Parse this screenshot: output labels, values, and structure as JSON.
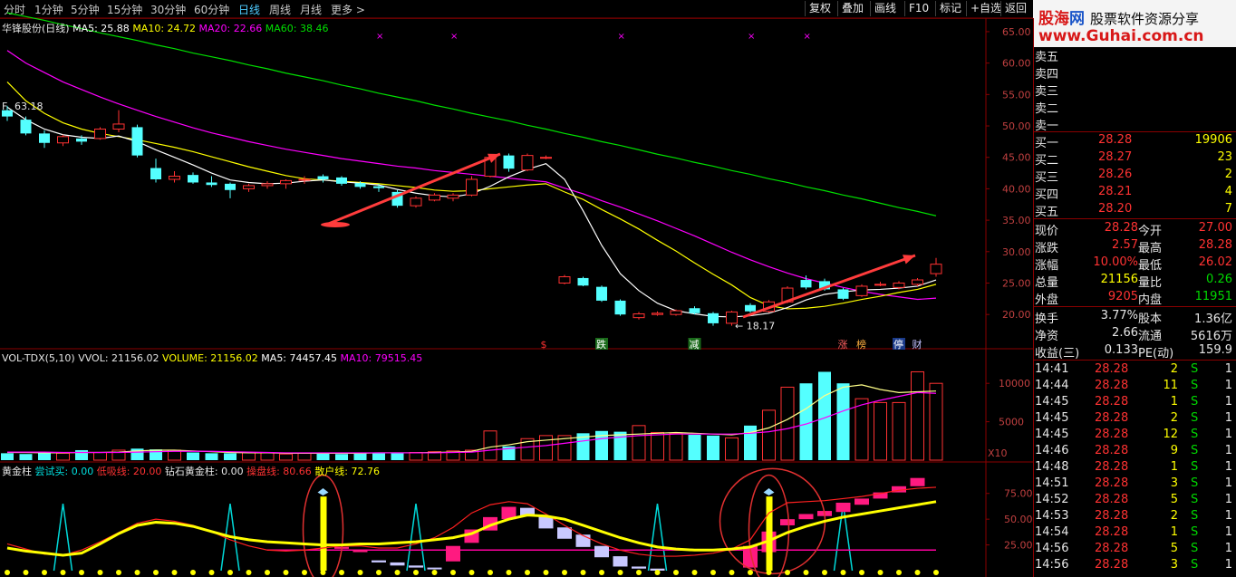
{
  "toolbar": {
    "periods": [
      "分时",
      "1分钟",
      "5分钟",
      "15分钟",
      "30分钟",
      "60分钟",
      "日线",
      "周线",
      "月线",
      "更多 >"
    ],
    "active": "日线",
    "buttons": [
      "复权",
      "叠加",
      "画线",
      "F10",
      "标记",
      "+自选",
      "返回"
    ]
  },
  "brand": {
    "name_part1": "股海",
    "name_part2": "网",
    "tagline": "股票软件资源分享",
    "url": "www.Guhai.com.cn"
  },
  "colors": {
    "up": "#ff3232",
    "down": "#54ffff",
    "ma5": "#ffffff",
    "ma10": "#ffff00",
    "ma20": "#ff00ff",
    "ma60": "#00e000",
    "grid": "#8a0000",
    "green": "#00d800"
  },
  "main_info": {
    "title": "华锋股份(日线)",
    "ma5": "MA5: 25.88",
    "ma10": "MA10: 24.72",
    "ma20": "MA20: 22.66",
    "ma60": "MA60: 38.46"
  },
  "vol_info": {
    "title": "VOL-TDX(5,10)",
    "vvol": "VVOL: 21156.02",
    "volume": "VOLUME: 21156.02",
    "ma5": "MA5: 74457.45",
    "ma10": "MA10: 79515.45"
  },
  "gold_info": {
    "title": "黄金柱",
    "try_buy": "尝试买: 0.00",
    "low_suck": "低吸线: 20.00",
    "diamond": "钻石黄金柱: 0.00",
    "operator": "操盘线: 80.66",
    "retail": "散户线: 72.76"
  },
  "price_axis": [
    "65.00",
    "60.00",
    "55.00",
    "50.00",
    "45.00",
    "40.00",
    "35.00",
    "30.00",
    "25.00",
    "20.00"
  ],
  "vol_axis": [
    "10000",
    "5000"
  ],
  "vol_unit": "X10",
  "gold_axis": [
    "75.00",
    "50.00",
    "25.00"
  ],
  "annotations": {
    "high": "63.18",
    "low": "18.17",
    "high_prefix": "F"
  },
  "event_labels": [
    {
      "text": "$",
      "color": "#ff3232"
    },
    {
      "text": "跌",
      "color": "#ffffff",
      "bg": "#1a6a1a"
    },
    {
      "text": "减",
      "color": "#ffffff",
      "bg": "#1a6a1a"
    },
    {
      "text": "涨",
      "color": "#ff6060"
    },
    {
      "text": "榜",
      "color": "#ffb040"
    },
    {
      "text": "停",
      "color": "#ffffff",
      "bg": "#1a3a8a"
    },
    {
      "text": "财",
      "color": "#c0c0ff"
    }
  ],
  "chart_data": {
    "type": "candlestick",
    "candles": [
      {
        "o": 52.5,
        "c": 51.5,
        "h": 53.2,
        "l": 50.8
      },
      {
        "o": 51.0,
        "c": 48.8,
        "h": 51.5,
        "l": 48.5
      },
      {
        "o": 48.8,
        "c": 47.3,
        "h": 49.3,
        "l": 46.5
      },
      {
        "o": 47.3,
        "c": 48.3,
        "h": 48.6,
        "l": 46.8
      },
      {
        "o": 48.0,
        "c": 47.5,
        "h": 48.5,
        "l": 47.0
      },
      {
        "o": 48.0,
        "c": 49.5,
        "h": 49.8,
        "l": 47.8
      },
      {
        "o": 49.5,
        "c": 50.3,
        "h": 52.5,
        "l": 49.0
      },
      {
        "o": 49.8,
        "c": 45.3,
        "h": 50.2,
        "l": 45.0
      },
      {
        "o": 43.3,
        "c": 41.5,
        "h": 44.8,
        "l": 41.0
      },
      {
        "o": 41.5,
        "c": 42.0,
        "h": 42.8,
        "l": 41.0
      },
      {
        "o": 42.2,
        "c": 41.0,
        "h": 42.6,
        "l": 40.8
      },
      {
        "o": 41.0,
        "c": 40.6,
        "h": 42.0,
        "l": 40.3
      },
      {
        "o": 40.8,
        "c": 39.8,
        "h": 41.0,
        "l": 38.5
      },
      {
        "o": 40.0,
        "c": 40.5,
        "h": 40.8,
        "l": 39.5
      },
      {
        "o": 40.5,
        "c": 40.8,
        "h": 41.2,
        "l": 40.0
      },
      {
        "o": 40.8,
        "c": 41.3,
        "h": 41.5,
        "l": 40.0
      },
      {
        "o": 41.5,
        "c": 41.5,
        "h": 42.0,
        "l": 40.8
      },
      {
        "o": 42.0,
        "c": 41.5,
        "h": 42.3,
        "l": 41.0
      },
      {
        "o": 41.8,
        "c": 40.8,
        "h": 42.0,
        "l": 40.5
      },
      {
        "o": 40.9,
        "c": 40.3,
        "h": 41.2,
        "l": 40.0
      },
      {
        "o": 40.4,
        "c": 40.1,
        "h": 40.8,
        "l": 39.5
      },
      {
        "o": 39.5,
        "c": 37.3,
        "h": 39.8,
        "l": 37.0
      },
      {
        "o": 37.3,
        "c": 38.5,
        "h": 38.8,
        "l": 37.0
      },
      {
        "o": 38.2,
        "c": 39.0,
        "h": 39.3,
        "l": 38.0
      },
      {
        "o": 38.5,
        "c": 39.0,
        "h": 39.3,
        "l": 38.0
      },
      {
        "o": 39.0,
        "c": 41.5,
        "h": 42.0,
        "l": 38.8
      },
      {
        "o": 42.0,
        "c": 45.0,
        "h": 45.3,
        "l": 41.8
      },
      {
        "o": 45.3,
        "c": 43.2,
        "h": 45.6,
        "l": 42.7
      },
      {
        "o": 43.0,
        "c": 45.3,
        "h": 45.6,
        "l": 42.8
      },
      {
        "o": 45.0,
        "c": 45.0,
        "h": 45.3,
        "l": 44.7
      },
      {
        "o": 25.0,
        "c": 26.0,
        "h": 26.3,
        "l": 24.8
      },
      {
        "o": 25.8,
        "c": 24.6,
        "h": 26.0,
        "l": 24.5
      },
      {
        "o": 24.4,
        "c": 22.2,
        "h": 24.6,
        "l": 22.0
      },
      {
        "o": 22.2,
        "c": 20.0,
        "h": 22.4,
        "l": 19.8
      },
      {
        "o": 19.5,
        "c": 20.1,
        "h": 20.4,
        "l": 19.2
      },
      {
        "o": 20.0,
        "c": 20.2,
        "h": 20.5,
        "l": 19.8
      },
      {
        "o": 20.0,
        "c": 20.6,
        "h": 20.8,
        "l": 19.8
      },
      {
        "o": 21.0,
        "c": 20.2,
        "h": 21.3,
        "l": 20.0
      },
      {
        "o": 20.2,
        "c": 18.6,
        "h": 20.4,
        "l": 18.2
      },
      {
        "o": 18.6,
        "c": 20.4,
        "h": 20.6,
        "l": 18.2
      },
      {
        "o": 21.5,
        "c": 20.5,
        "h": 21.8,
        "l": 20.3
      },
      {
        "o": 20.5,
        "c": 22.0,
        "h": 22.3,
        "l": 20.3
      },
      {
        "o": 22.0,
        "c": 24.2,
        "h": 24.5,
        "l": 21.8
      },
      {
        "o": 25.5,
        "c": 24.3,
        "h": 26.2,
        "l": 24.0
      },
      {
        "o": 25.3,
        "c": 24.0,
        "h": 25.7,
        "l": 23.8
      },
      {
        "o": 24.0,
        "c": 22.5,
        "h": 24.2,
        "l": 22.3
      },
      {
        "o": 23.0,
        "c": 24.5,
        "h": 24.8,
        "l": 22.8
      },
      {
        "o": 24.8,
        "c": 24.8,
        "h": 25.2,
        "l": 24.5
      },
      {
        "o": 24.3,
        "c": 25.0,
        "h": 25.3,
        "l": 24.0
      },
      {
        "o": 24.8,
        "c": 25.5,
        "h": 25.8,
        "l": 24.5
      },
      {
        "o": 26.5,
        "c": 28.0,
        "h": 29.0,
        "l": 26.0
      }
    ],
    "ma5": [
      53,
      51,
      49.5,
      48.6,
      48.2,
      48,
      48.4,
      47.5,
      46.2,
      45,
      43.8,
      42.5,
      41.4,
      41,
      40.8,
      40.9,
      41.2,
      41.4,
      41.1,
      40.9,
      40.6,
      39.9,
      39.3,
      38.9,
      38.7,
      39.2,
      40.4,
      41.9,
      43.1,
      44,
      41.5,
      36.5,
      31,
      26.5,
      23.8,
      21.8,
      20.6,
      20.1,
      19.7,
      19.6,
      19.8,
      20.2,
      21.1,
      22.3,
      23.2,
      23.6,
      23.9,
      24,
      24.2,
      24.5,
      25.5
    ],
    "ma10": [
      57,
      54,
      52,
      50.5,
      49.5,
      48.8,
      48.3,
      47.8,
      47.2,
      46.6,
      45.9,
      45.1,
      44.3,
      43.5,
      42.8,
      42.1,
      41.6,
      41.4,
      41.2,
      41,
      40.8,
      40.5,
      40.2,
      39.8,
      39.6,
      39.7,
      40,
      40.3,
      40.6,
      40.8,
      39.5,
      38.3,
      36.7,
      35.2,
      33.6,
      31.8,
      30.1,
      28.2,
      26.4,
      24.7,
      22.7,
      21.4,
      20.9,
      21,
      21.3,
      21.8,
      22.4,
      22.9,
      23.5,
      24,
      24.8
    ],
    "ma20": [
      62,
      60,
      58.5,
      57,
      55.8,
      54.6,
      53.5,
      52.5,
      51.5,
      50.6,
      49.7,
      48.9,
      48.2,
      47.5,
      46.9,
      46.3,
      45.8,
      45.3,
      44.8,
      44.4,
      44,
      43.6,
      43.3,
      42.9,
      42.6,
      42.3,
      42,
      41.7,
      41.4,
      41.1,
      40.1,
      39.2,
      38.1,
      37.1,
      36,
      34.9,
      33.7,
      32.5,
      31.2,
      29.9,
      28.7,
      27.6,
      26.6,
      25.7,
      25,
      24.3,
      23.7,
      23.2,
      22.8,
      22.4,
      22.6
    ],
    "ma60": [
      68,
      67.4,
      66.8,
      66.1,
      65.5,
      64.8,
      64.2,
      63.6,
      62.9,
      62.3,
      61.6,
      61,
      60.4,
      59.7,
      59.1,
      58.4,
      57.8,
      57.2,
      56.5,
      55.9,
      55.2,
      54.6,
      54,
      53.3,
      52.7,
      52,
      51.4,
      50.8,
      50.1,
      49.5,
      48.8,
      48.2,
      47.5,
      46.9,
      46.2,
      45.5,
      44.9,
      44.2,
      43.6,
      42.9,
      42.3,
      41.6,
      41,
      40.3,
      39.7,
      39,
      38.4,
      37.7,
      37,
      36.4,
      35.7
    ],
    "volumes": [
      900,
      800,
      1000,
      900,
      1300,
      1000,
      1300,
      1500,
      1400,
      1300,
      1000,
      900,
      900,
      1000,
      1000,
      800,
      900,
      900,
      800,
      900,
      1000,
      1000,
      1000,
      1100,
      1200,
      1300,
      3800,
      1800,
      2800,
      3200,
      3200,
      3500,
      3800,
      3700,
      4500,
      3600,
      3500,
      3300,
      3200,
      2900,
      4500,
      6500,
      9500,
      10000,
      11500,
      10000,
      8000,
      7500,
      7500,
      11500,
      10000
    ],
    "vol_ma5": [
      1000,
      1000,
      950,
      950,
      1000,
      1000,
      1050,
      1200,
      1300,
      1300,
      1200,
      1100,
      1000,
      950,
      950,
      900,
      900,
      900,
      900,
      900,
      950,
      950,
      950,
      1000,
      1050,
      1150,
      1700,
      2000,
      2400,
      2600,
      2800,
      3000,
      3200,
      3300,
      3400,
      3500,
      3600,
      3500,
      3400,
      3300,
      3600,
      4200,
      5300,
      6700,
      8400,
      9500,
      9800,
      9200,
      8800,
      8900,
      9000
    ],
    "vol_ma10": [
      1050,
      1050,
      1050,
      1000,
      1000,
      1000,
      1000,
      1050,
      1100,
      1150,
      1150,
      1150,
      1100,
      1050,
      1000,
      950,
      950,
      950,
      950,
      950,
      950,
      950,
      950,
      950,
      1000,
      1050,
      1300,
      1500,
      1700,
      1900,
      2200,
      2500,
      2800,
      3000,
      3200,
      3300,
      3400,
      3400,
      3400,
      3400,
      3500,
      3700,
      4100,
      4700,
      5500,
      6400,
      7200,
      7800,
      8300,
      8800,
      8700
    ],
    "gold_bars": [
      null,
      null,
      null,
      null,
      null,
      null,
      null,
      null,
      null,
      null,
      null,
      null,
      null,
      null,
      null,
      null,
      null,
      null,
      {
        "b": 22,
        "t": 23
      },
      {
        "b": 18,
        "t": 20
      },
      {
        "b": 8,
        "t": 10
      },
      {
        "b": 5,
        "t": 8
      },
      {
        "b": 3,
        "t": 5
      },
      {
        "b": 2,
        "t": 3
      },
      {
        "b": 9,
        "t": 24
      },
      {
        "b": 27,
        "t": 40
      },
      {
        "b": 39,
        "t": 52
      },
      {
        "b": 50,
        "t": 62
      },
      {
        "b": 53,
        "t": 61
      },
      {
        "b": 41,
        "t": 53
      },
      {
        "b": 31,
        "t": 42
      },
      {
        "b": 23,
        "t": 35
      },
      {
        "b": 13,
        "t": 24
      },
      {
        "b": 4,
        "t": 14
      },
      {
        "b": 2,
        "t": 4
      },
      {
        "b": 0,
        "t": 2
      },
      null,
      null,
      null,
      null,
      {
        "b": 3,
        "t": 24
      },
      {
        "b": 18,
        "t": 38
      },
      {
        "b": 44,
        "t": 50
      },
      {
        "b": 50,
        "t": 55
      },
      {
        "b": 53,
        "t": 58
      },
      {
        "b": 57,
        "t": 66
      },
      {
        "b": 64,
        "t": 70
      },
      {
        "b": 70,
        "t": 76
      },
      {
        "b": 76,
        "t": 82
      },
      {
        "b": 82,
        "t": 90
      },
      null
    ],
    "gold_bar_dir": [
      "",
      "",
      "",
      "",
      "",
      "",
      "",
      "",
      "",
      "",
      "",
      "",
      "",
      "",
      "",
      "",
      "",
      "",
      "u",
      "u",
      "d",
      "d",
      "d",
      "d",
      "u",
      "u",
      "u",
      "u",
      "d",
      "d",
      "d",
      "d",
      "d",
      "d",
      "d",
      "d",
      "",
      "",
      "",
      "",
      "u",
      "u",
      "u",
      "u",
      "u",
      "u",
      "u",
      "u",
      "u",
      "u",
      ""
    ],
    "tall_yellow": [
      17,
      41
    ],
    "operator_line": [
      22,
      19,
      17,
      15,
      17,
      26,
      36,
      44,
      47,
      46,
      43,
      38,
      33,
      30,
      28,
      27,
      26,
      25,
      25,
      26,
      26,
      27,
      28,
      30,
      32,
      36,
      44,
      50,
      54,
      53,
      50,
      44,
      38,
      32,
      27,
      23,
      21,
      20,
      20,
      21,
      23,
      29,
      37,
      43,
      48,
      52,
      55,
      58,
      61,
      64,
      67
    ],
    "retail_line": [
      26,
      21,
      16,
      15,
      20,
      28,
      37,
      46,
      50,
      48,
      44,
      38,
      30,
      24,
      20,
      19,
      20,
      22,
      24,
      24,
      22,
      22,
      26,
      32,
      42,
      56,
      64,
      67,
      65,
      55,
      44,
      34,
      26,
      20,
      16,
      14,
      14,
      15,
      17,
      21,
      30,
      56,
      66,
      67,
      68,
      70,
      72,
      75,
      78,
      80,
      81
    ],
    "spikes": [
      3,
      12,
      22,
      35,
      45
    ],
    "low_suck": 20,
    "price_range": [
      17,
      66
    ],
    "vol_range": [
      0,
      12500
    ],
    "gold_range": [
      0,
      95
    ]
  },
  "order_book": {
    "sells": [
      {
        "label": "卖五"
      },
      {
        "label": "卖四"
      },
      {
        "label": "卖三"
      },
      {
        "label": "卖二"
      },
      {
        "label": "卖一"
      }
    ],
    "buys": [
      {
        "label": "买一",
        "price": "28.28",
        "vol": "19906"
      },
      {
        "label": "买二",
        "price": "28.27",
        "vol": "23"
      },
      {
        "label": "买三",
        "price": "28.26",
        "vol": "2"
      },
      {
        "label": "买四",
        "price": "28.21",
        "vol": "4"
      },
      {
        "label": "买五",
        "price": "28.20",
        "vol": "7"
      }
    ]
  },
  "quote": [
    {
      "l1": "现价",
      "v1": "28.28",
      "l2": "今开",
      "v2": "27.00",
      "c1": "#ff3232",
      "c2": "#ff3232"
    },
    {
      "l1": "涨跌",
      "v1": "2.57",
      "l2": "最高",
      "v2": "28.28",
      "c1": "#ff3232",
      "c2": "#ff3232"
    },
    {
      "l1": "涨幅",
      "v1": "10.00%",
      "l2": "最低",
      "v2": "26.02",
      "c1": "#ff3232",
      "c2": "#ff3232"
    },
    {
      "l1": "总量",
      "v1": "21156",
      "l2": "量比",
      "v2": "0.26",
      "c1": "#ffff00",
      "c2": "#00d800"
    },
    {
      "l1": "外盘",
      "v1": "9205",
      "l2": "内盘",
      "v2": "11951",
      "c1": "#ff3232",
      "c2": "#00d800"
    }
  ],
  "stats": [
    {
      "l1": "换手",
      "v1": "3.77%",
      "l2": "股本",
      "v2": "1.36亿"
    },
    {
      "l1": "净资",
      "v1": "2.66",
      "l2": "流通",
      "v2": "5616万"
    },
    {
      "l1": "收益(三)",
      "v1": "0.133",
      "l2": "PE(动)",
      "v2": "159.9"
    }
  ],
  "ticks": [
    {
      "time": "14:41",
      "price": "28.28",
      "vol": "2",
      "side": "S",
      "n": "1"
    },
    {
      "time": "14:44",
      "price": "28.28",
      "vol": "11",
      "side": "S",
      "n": "1"
    },
    {
      "time": "14:45",
      "price": "28.28",
      "vol": "1",
      "side": "S",
      "n": "1"
    },
    {
      "time": "14:45",
      "price": "28.28",
      "vol": "2",
      "side": "S",
      "n": "1"
    },
    {
      "time": "14:45",
      "price": "28.28",
      "vol": "12",
      "side": "S",
      "n": "1"
    },
    {
      "time": "14:46",
      "price": "28.28",
      "vol": "9",
      "side": "S",
      "n": "1"
    },
    {
      "time": "14:48",
      "price": "28.28",
      "vol": "1",
      "side": "S",
      "n": "1"
    },
    {
      "time": "14:51",
      "price": "28.28",
      "vol": "3",
      "side": "S",
      "n": "1"
    },
    {
      "time": "14:52",
      "price": "28.28",
      "vol": "5",
      "side": "S",
      "n": "1"
    },
    {
      "time": "14:53",
      "price": "28.28",
      "vol": "2",
      "side": "S",
      "n": "1"
    },
    {
      "time": "14:54",
      "price": "28.28",
      "vol": "1",
      "side": "S",
      "n": "1"
    },
    {
      "time": "14:56",
      "price": "28.28",
      "vol": "5",
      "side": "S",
      "n": "1"
    },
    {
      "time": "14:56",
      "price": "28.28",
      "vol": "3",
      "side": "S",
      "n": "1"
    }
  ]
}
